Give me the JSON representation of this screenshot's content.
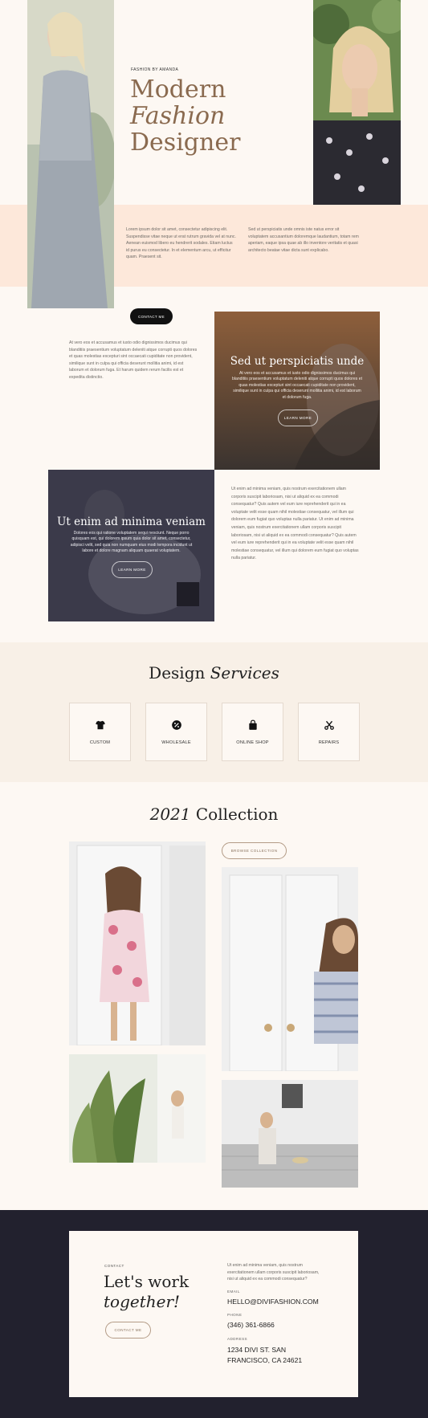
{
  "hero": {
    "eyebrow": "FASHION BY AMANDA",
    "title_line1": "Modern",
    "title_line2": "Fashion",
    "title_line3": "Designer",
    "para_left": "Lorem ipsum dolor sit amet, consectetur adipiscing elit. Suspendisse vitae neque ut erat rutrum gravida vel at nunc. Aenean euismod libero eu hendrerit sodales. Etiam luctus id purus eu consectetur. In et elementum arcu, ut efficitur quam. Praesent sit.",
    "para_right": "Sed ut perspiciatis unde omnis iste natus error sit voluptatem accusantium doloremque laudantium, totam rem aperiam, eaque ipsa quae ab illo inventore veritatis et quasi architecto beatae vitae dicta sunt explicabo.",
    "contact_button": "CONTACT ME"
  },
  "about": {
    "para": "At vero eos et accusamus et iusto odio dignissimos ducimus qui blanditiis praesentium voluptatum deleniti atque corrupti quos dolores et quas molestias excepturi sint occaecati cupiditate non provident, similique sunt in culpa qui officia deserunt mollitia animi, id est laborum et dolorum fuga. Et harum quidem rerum facilis est et expedita distinctio.",
    "card1": {
      "title": "Sed ut perspiciatis unde",
      "text": "At vero eos et accusamus et iusto odio dignissimos ducimus qui blanditiis praesentium voluptatum deleniti atque corrupti quos dolores et quas molestias excepturi sint occaecati cupiditate non provident, similique sunt in culpa qui officia deserunt mollitia animi, id est laborum et dolorum fuga.",
      "button": "LEARN MORE"
    },
    "card2": {
      "title": "Ut enim ad minima veniam",
      "text": "Dolores eos qui ratione voluptatem sequi nesciunt. Neque porro quisquam est, qui dolorem ipsum quia dolor sit amet, consectetur, adipisci velit, sed quia non numquam eius modi tempora incidunt ut labore et dolore magnam aliquam quaerat voluptatem.",
      "button": "LEARN MORE"
    },
    "para2": "Ut enim ad minima veniam, quis nostrum exercitationem ullam corporis suscipit laboriosam, nisi ut aliquid ex ea commodi consequatur? Quis autem vel eum iure reprehenderit qui in ea voluptate velit esse quam nihil molestiae consequatur, vel illum qui dolorem eum fugiat quo voluptas nulla pariatur. Ut enim ad minima veniam, quis nostrum exercitationem ullam corporis suscipit laboriosam, nisi ut aliquid ex ea commodi consequatur? Quis autem vel eum iure reprehenderit qui in ea voluptate velit esse quam nihil molestiae consequatur, vel illum qui dolorem eum fugiat quo voluptas nulla pariatur."
  },
  "services": {
    "title_plain": "Design",
    "title_italic": "Services",
    "items": [
      {
        "label": "CUSTOM",
        "icon": "tshirt-icon"
      },
      {
        "label": "WHOLESALE",
        "icon": "percent-icon"
      },
      {
        "label": "ONLINE SHOP",
        "icon": "shopping-bag-icon"
      },
      {
        "label": "REPAIRS",
        "icon": "scissors-icon"
      }
    ]
  },
  "collection": {
    "title_italic": "2021",
    "title_plain": "Collection",
    "browse_button": "BROWSE COLLECTION"
  },
  "contact": {
    "eyebrow": "CONTACT",
    "title_line1": "Let's work",
    "title_line2": "together!",
    "button": "CONTACT ME",
    "intro": "Ut enim ad minima veniam, quis nostrum exercitationem ullam corporis suscipit laboriosam, nisi ut aliquid ex ea commodi consequatur?",
    "email_label": "EMAIL",
    "email": "HELLO@DIVIFASHION.COM",
    "phone_label": "PHONE",
    "phone": "(346) 361-6866",
    "address_label": "ADDRESS",
    "address_line1": "1234 DIVI ST. SAN",
    "address_line2": "FRANCISCO, CA 24621"
  },
  "colors": {
    "background": "#fdf8f3",
    "peach_band": "#fde8da",
    "title_brown": "#8a6a4f",
    "dark_navy": "#22212e",
    "services_band": "#f8f0e7"
  }
}
